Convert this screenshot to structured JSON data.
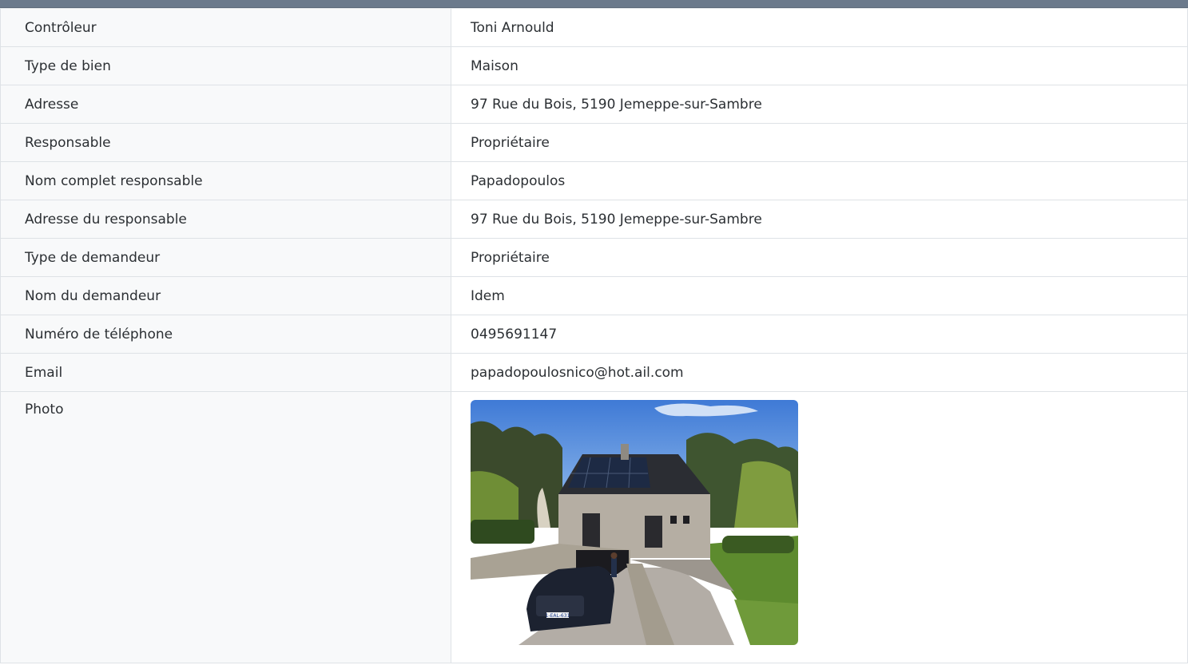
{
  "rows": [
    {
      "label": "Contrôleur",
      "value": "Toni Arnould"
    },
    {
      "label": "Type de bien",
      "value": "Maison"
    },
    {
      "label": "Adresse",
      "value": "97 Rue du Bois, 5190 Jemeppe-sur-Sambre"
    },
    {
      "label": "Responsable",
      "value": "Propriétaire"
    },
    {
      "label": "Nom complet responsable",
      "value": "Papadopoulos"
    },
    {
      "label": "Adresse du responsable",
      "value": "97 Rue du Bois, 5190 Jemeppe-sur-Sambre"
    },
    {
      "label": "Type de demandeur",
      "value": "Propriétaire"
    },
    {
      "label": "Nom du demandeur",
      "value": "Idem"
    },
    {
      "label": "Numéro de téléphone",
      "value": "0495691147"
    },
    {
      "label": "Email",
      "value": "papadopoulosnico@hot.ail.com"
    }
  ],
  "photo": {
    "label": "Photo",
    "license_plate": "1-EAL-631"
  },
  "colors": {
    "header_bar": "#6b7a8c",
    "border": "#dee2e6",
    "label_bg": "#f8f9fa"
  }
}
